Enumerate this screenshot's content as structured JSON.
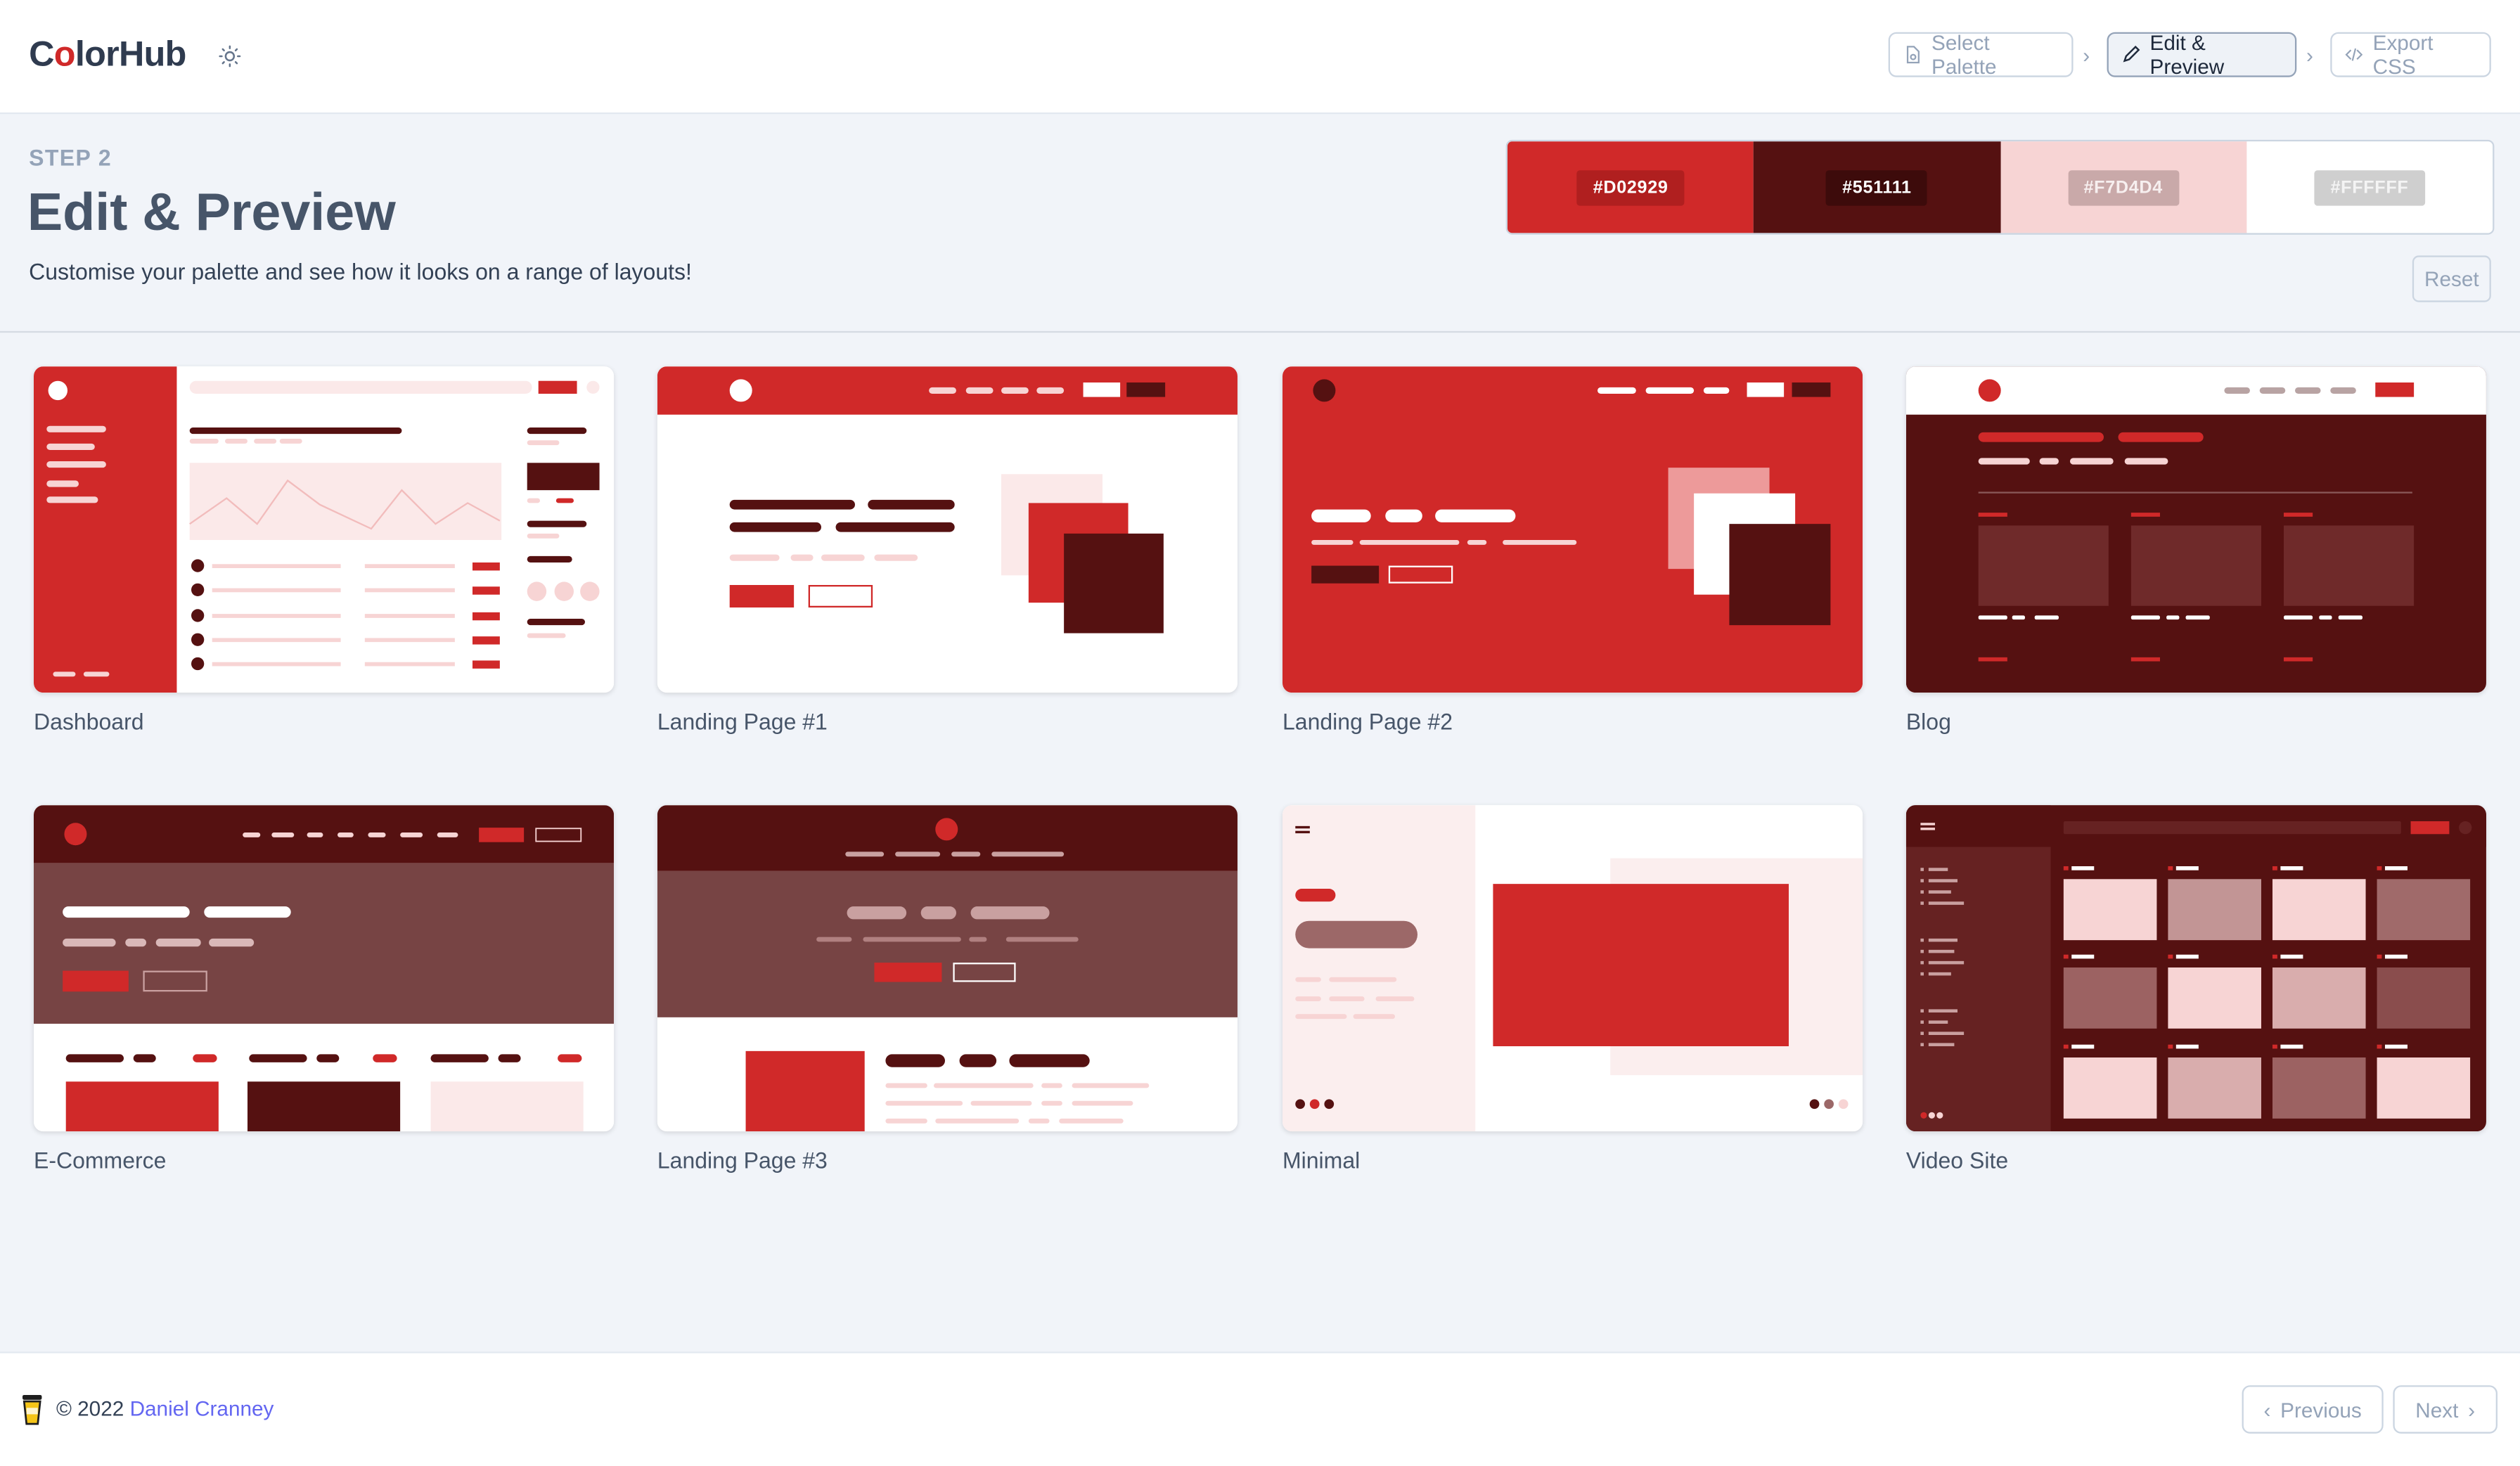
{
  "header": {
    "logo_prefix": "C",
    "logo_o": "o",
    "logo_rest": "lorHub",
    "steps": [
      {
        "label": "Select Palette",
        "icon": "palette-doc-icon",
        "active": false
      },
      {
        "label": "Edit & Preview",
        "icon": "pencil-icon",
        "active": true
      },
      {
        "label": "Export CSS",
        "icon": "code-icon",
        "active": false
      }
    ]
  },
  "intro": {
    "step": "STEP 2",
    "title": "Edit & Preview",
    "subtitle": "Customise your palette and see how it looks on a range of layouts!"
  },
  "palette": {
    "swatches": [
      {
        "hex": "#D02929",
        "bg": "#d02929",
        "chip_bg": "#b01f1f",
        "chip_fg": "#ffffff"
      },
      {
        "hex": "#551111",
        "bg": "#551111",
        "chip_bg": "#3d0b0b",
        "chip_fg": "#ffffff"
      },
      {
        "hex": "#F7D4D4",
        "bg": "#f7d4d4",
        "chip_bg": "#c9a9a9",
        "chip_fg": "#f7efef"
      },
      {
        "hex": "#FFFFFF",
        "bg": "#ffffff",
        "chip_bg": "#cfcfcf",
        "chip_fg": "#f4f4f4"
      }
    ],
    "reset_label": "Reset"
  },
  "colors": {
    "primary": "#d02929",
    "dark": "#551111",
    "light": "#f7d4d4",
    "white": "#ffffff"
  },
  "templates": [
    {
      "label": "Dashboard"
    },
    {
      "label": "Landing Page #1"
    },
    {
      "label": "Landing Page #2"
    },
    {
      "label": "Blog"
    },
    {
      "label": "E-Commerce"
    },
    {
      "label": "Landing Page #3"
    },
    {
      "label": "Minimal"
    },
    {
      "label": "Video Site"
    }
  ],
  "footer": {
    "copyright": "© 2022",
    "author": "Daniel Cranney",
    "previous_label": "Previous",
    "next_label": "Next"
  }
}
